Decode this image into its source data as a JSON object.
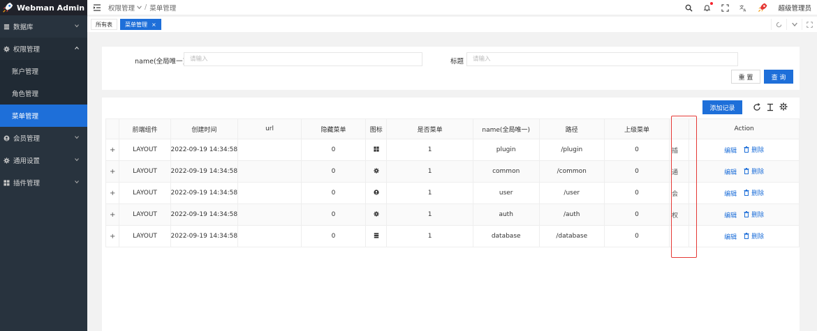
{
  "app": {
    "title": "Webman Admin"
  },
  "sidebar": {
    "items": [
      {
        "label": "数据库",
        "icon": "database-icon"
      },
      {
        "label": "权限管理",
        "icon": "gear-icon",
        "open": true,
        "children": [
          {
            "label": "账户管理"
          },
          {
            "label": "角色管理"
          },
          {
            "label": "菜单管理",
            "active": true
          }
        ]
      },
      {
        "label": "会员管理",
        "icon": "user-circle-icon"
      },
      {
        "label": "通用设置",
        "icon": "gear-icon"
      },
      {
        "label": "插件管理",
        "icon": "grid-icon"
      }
    ]
  },
  "header": {
    "breadcrumb": [
      "权限管理",
      "菜单管理"
    ],
    "user": "超级管理员",
    "icons": [
      "search-icon",
      "bell-icon",
      "fullscreen-icon",
      "translate-icon",
      "avatar"
    ]
  },
  "tabs": [
    {
      "label": "所有表"
    },
    {
      "label": "菜单管理",
      "active": true,
      "close": "×"
    }
  ],
  "search": {
    "name_label": "name(全局唯一)",
    "name_placeholder": "请输入",
    "title_label": "标题",
    "title_placeholder": "请输入",
    "reset_label": "重 置",
    "query_label": "查 询"
  },
  "toolbar": {
    "add_label": "添加记录"
  },
  "table": {
    "headers": [
      "",
      "前端组件",
      "创建时间",
      "url",
      "隐藏菜单",
      "图标",
      "是否菜单",
      "name(全局唯一)",
      "路径",
      "上级菜单",
      "",
      "Action"
    ],
    "rows": [
      {
        "expand": "+",
        "component": "LAYOUT",
        "created": "2022-09-19 14:34:58",
        "url": "",
        "hidden": "0",
        "icon": "grid-icon",
        "is_menu": "1",
        "name": "plugin",
        "path": "/plugin",
        "parent": "0",
        "clip": "插"
      },
      {
        "expand": "+",
        "component": "LAYOUT",
        "created": "2022-09-19 14:34:58",
        "url": "",
        "hidden": "0",
        "icon": "gear-icon",
        "is_menu": "1",
        "name": "common",
        "path": "/common",
        "parent": "0",
        "clip": "通"
      },
      {
        "expand": "+",
        "component": "LAYOUT",
        "created": "2022-09-19 14:34:58",
        "url": "",
        "hidden": "0",
        "icon": "user-circle-icon",
        "is_menu": "1",
        "name": "user",
        "path": "/user",
        "parent": "0",
        "clip": "会"
      },
      {
        "expand": "+",
        "component": "LAYOUT",
        "created": "2022-09-19 14:34:58",
        "url": "",
        "hidden": "0",
        "icon": "gear-icon",
        "is_menu": "1",
        "name": "auth",
        "path": "/auth",
        "parent": "0",
        "clip": "权"
      },
      {
        "expand": "+",
        "component": "LAYOUT",
        "created": "2022-09-19 14:34:58",
        "url": "",
        "hidden": "0",
        "icon": "database-icon",
        "is_menu": "1",
        "name": "database",
        "path": "/database",
        "parent": "0",
        "clip": ""
      }
    ],
    "edit_label": "编辑",
    "delete_label": "删除"
  },
  "colors": {
    "primary": "#1e6fd9",
    "sidebar": "#28333e",
    "highlight": "#e53935"
  }
}
